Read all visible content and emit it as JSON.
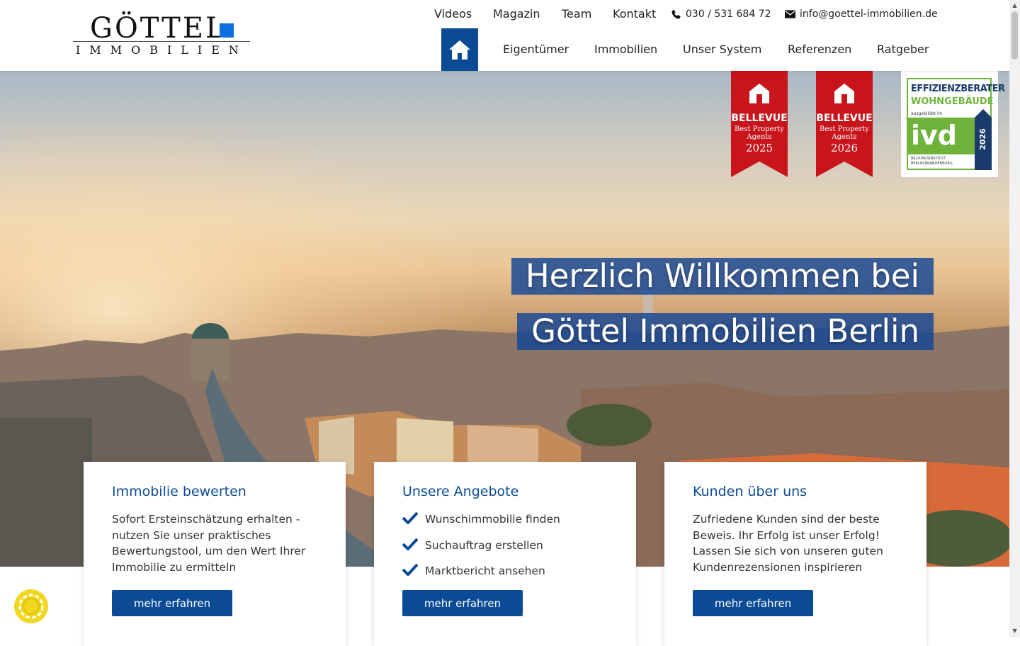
{
  "logo": {
    "name": "GÖTTEL",
    "sub": "IMMOBILIEN"
  },
  "top_nav": [
    "Videos",
    "Magazin",
    "Team",
    "Kontakt"
  ],
  "contact": {
    "phone": "030 / 531 684 72",
    "email": "info@goettel-immobilien.de"
  },
  "main_nav": [
    "Eigentümer",
    "Immobilien",
    "Unser System",
    "Referenzen",
    "Ratgeber"
  ],
  "badges": [
    {
      "brand": "BELLEVUE",
      "line1": "Best Property",
      "line2": "Agents",
      "year": "2025"
    },
    {
      "brand": "BELLEVUE",
      "line1": "Best Property",
      "line2": "Agents",
      "year": "2026"
    }
  ],
  "ivd": {
    "title1": "EFFIZIENZBERATER",
    "title2": "WOHNGEBÄUDE",
    "small": "ausgebildet im",
    "logo": "ivd",
    "year": "2026",
    "footer1": "BILDUNGSINSTITUT",
    "footer2": "BERLIN-BRANDENBURG"
  },
  "hero": {
    "line1": "Herzlich Willkommen bei",
    "line2": "Göttel Immobilien Berlin"
  },
  "cards": [
    {
      "title": "Immobilie bewerten",
      "text": "Sofort Ersteinschätzung erhalten - nutzen Sie unser praktisches Bewertungstool, um den Wert Ihrer Immobilie zu ermitteln",
      "button": "mehr erfahren"
    },
    {
      "title": "Unsere Angebote",
      "items": [
        "Wunschimmobilie finden",
        "Suchauftrag erstellen",
        "Marktbericht ansehen"
      ],
      "button": "mehr erfahren"
    },
    {
      "title": "Kunden über uns",
      "text": "Zufriedene Kunden sind der beste Beweis. Ihr Erfolg ist unser Erfolg! Lassen Sie sich von unseren guten Kundenrezensionen inspirieren",
      "button": "mehr erfahren"
    }
  ],
  "colors": {
    "brand_blue": "#0b4b96",
    "accent_square": "#0d6ee0",
    "badge_red": "#c8141b",
    "cookie_yellow": "#f2d722"
  },
  "icons": {
    "phone": "phone-icon",
    "email": "envelope-icon",
    "home": "home-icon",
    "check": "checkmark-icon",
    "cookie": "cookie-settings-icon"
  }
}
